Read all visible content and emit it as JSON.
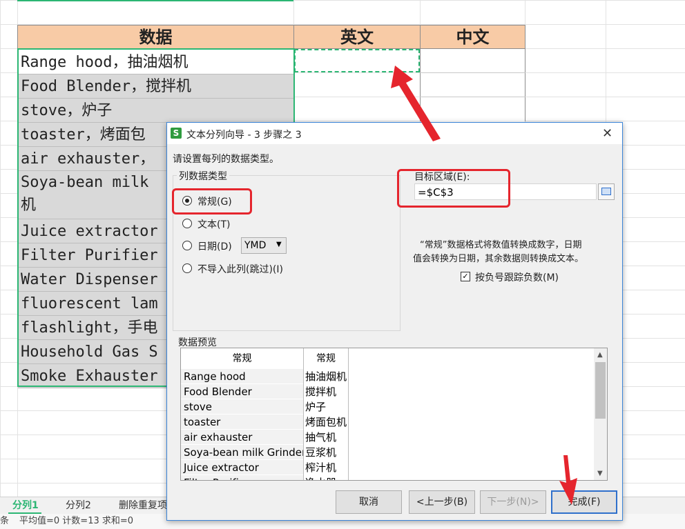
{
  "sheet": {
    "headers": [
      "数据",
      "英文",
      "中文"
    ],
    "rows": [
      "Range hood，抽油烟机",
      "Food Blender，搅拌机",
      "stove，炉子",
      "toaster，烤面包",
      "air exhauster，",
      "Soya-bean milk",
      "Juice extractor",
      "Filter Purifier",
      "Water Dispenser",
      "fluorescent lam",
      "flashlight，手电",
      "Household Gas S",
      "Smoke Exhauster"
    ],
    "row6_wrap": "机"
  },
  "tabs": [
    "分列1",
    "分列2",
    "删除重复项"
  ],
  "status": {
    "left": "条",
    "text": "平均值=0  计数=13  求和=0"
  },
  "dialog": {
    "title": "文本分列向导 - 3 步骤之 3",
    "close": "✕",
    "app_icon": "S",
    "instruction": "请设置每列的数据类型。",
    "group_label": "列数据类型",
    "options": [
      "常规(G)",
      "文本(T)",
      "日期(D)",
      "不导入此列(跳过)(I)"
    ],
    "selected_option": "常规(G)",
    "date_format": "YMD",
    "target_label": "目标区域(E):",
    "target_value": "=$C$3",
    "info_line1": "“常规”数据格式将数值转换成数字，日期",
    "info_line2": "值会转换为日期，其余数据则转换成文本。",
    "checkbox_label": "按负号跟踪负数(M)",
    "checkbox_checked": true,
    "preview_label": "数据预览",
    "preview_headers": [
      "常规",
      "常规"
    ],
    "preview_rows": [
      [
        "Range hood",
        "抽油烟机"
      ],
      [
        "Food Blender",
        "搅拌机"
      ],
      [
        "stove",
        "炉子"
      ],
      [
        "toaster",
        "烤面包机"
      ],
      [
        "air exhauster",
        "抽气机"
      ],
      [
        "Soya-bean milk Grinder",
        "豆浆机"
      ],
      [
        "Juice extractor",
        "榨汁机"
      ],
      [
        "Filter Purifier",
        "净水器"
      ]
    ],
    "buttons": {
      "cancel": "取消",
      "back": "<上一步(B)",
      "next": "下一步(N)>",
      "finish": "完成(F)"
    }
  },
  "colors": {
    "accent": "#2e6fcb",
    "annotation": "#e5252d",
    "header_fill": "#f8cba6",
    "selection": "#2bb673"
  }
}
